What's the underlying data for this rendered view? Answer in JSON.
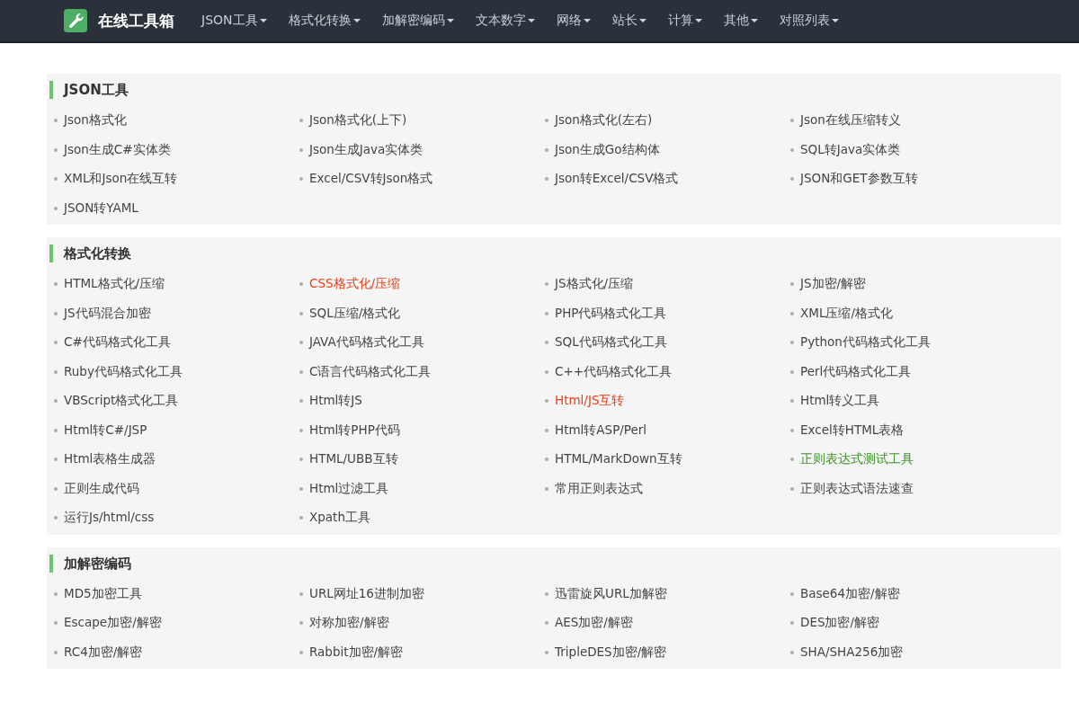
{
  "brand": {
    "title": "在线工具箱"
  },
  "nav": [
    {
      "label": "JSON工具"
    },
    {
      "label": "格式化转换"
    },
    {
      "label": "加解密编码"
    },
    {
      "label": "文本数字"
    },
    {
      "label": "网络"
    },
    {
      "label": "站长"
    },
    {
      "label": "计算"
    },
    {
      "label": "其他"
    },
    {
      "label": "对照列表"
    }
  ],
  "sections": [
    {
      "title": "JSON工具",
      "items": [
        {
          "label": "Json格式化"
        },
        {
          "label": "Json格式化(上下)"
        },
        {
          "label": "Json格式化(左右)"
        },
        {
          "label": "Json在线压缩转义"
        },
        {
          "label": "Json生成C#实体类"
        },
        {
          "label": "Json生成Java实体类"
        },
        {
          "label": "Json生成Go结构体"
        },
        {
          "label": "SQL转Java实体类"
        },
        {
          "label": "XML和Json在线互转"
        },
        {
          "label": "Excel/CSV转Json格式"
        },
        {
          "label": "Json转Excel/CSV格式"
        },
        {
          "label": "JSON和GET参数互转"
        },
        {
          "label": "JSON转YAML"
        }
      ]
    },
    {
      "title": "格式化转换",
      "items": [
        {
          "label": "HTML格式化/压缩"
        },
        {
          "label": "CSS格式化/压缩",
          "color": "#e8401c"
        },
        {
          "label": "JS格式化/压缩"
        },
        {
          "label": "JS加密/解密"
        },
        {
          "label": "JS代码混合加密"
        },
        {
          "label": "SQL压缩/格式化"
        },
        {
          "label": "PHP代码格式化工具"
        },
        {
          "label": "XML压缩/格式化"
        },
        {
          "label": "C#代码格式化工具"
        },
        {
          "label": "JAVA代码格式化工具"
        },
        {
          "label": "SQL代码格式化工具"
        },
        {
          "label": "Python代码格式化工具"
        },
        {
          "label": "Ruby代码格式化工具"
        },
        {
          "label": "C语言代码格式化工具"
        },
        {
          "label": "C++代码格式化工具"
        },
        {
          "label": "Perl代码格式化工具"
        },
        {
          "label": "VBScript格式化工具"
        },
        {
          "label": "Html转JS"
        },
        {
          "label": "Html/JS互转",
          "color": "#e8401c"
        },
        {
          "label": "Html转义工具"
        },
        {
          "label": "Html转C#/JSP"
        },
        {
          "label": "Html转PHP代码"
        },
        {
          "label": "Html转ASP/Perl"
        },
        {
          "label": "Excel转HTML表格"
        },
        {
          "label": "Html表格生成器"
        },
        {
          "label": "HTML/UBB互转"
        },
        {
          "label": "HTML/MarkDown互转"
        },
        {
          "label": "正则表达式测试工具",
          "color": "#3f8f2a"
        },
        {
          "label": "正则生成代码"
        },
        {
          "label": "Html过滤工具"
        },
        {
          "label": "常用正则表达式"
        },
        {
          "label": "正则表达式语法速查"
        },
        {
          "label": "运行Js/html/css"
        },
        {
          "label": "Xpath工具"
        }
      ]
    },
    {
      "title": "加解密编码",
      "items": [
        {
          "label": "MD5加密工具"
        },
        {
          "label": "URL网址16进制加密"
        },
        {
          "label": "迅雷旋风URL加解密"
        },
        {
          "label": "Base64加密/解密"
        },
        {
          "label": "Escape加密/解密"
        },
        {
          "label": "对称加密/解密"
        },
        {
          "label": "AES加密/解密"
        },
        {
          "label": "DES加密/解密"
        },
        {
          "label": "RC4加密/解密"
        },
        {
          "label": "Rabbit加密/解密"
        },
        {
          "label": "TripleDES加密/解密"
        },
        {
          "label": "SHA/SHA256加密"
        }
      ]
    }
  ]
}
